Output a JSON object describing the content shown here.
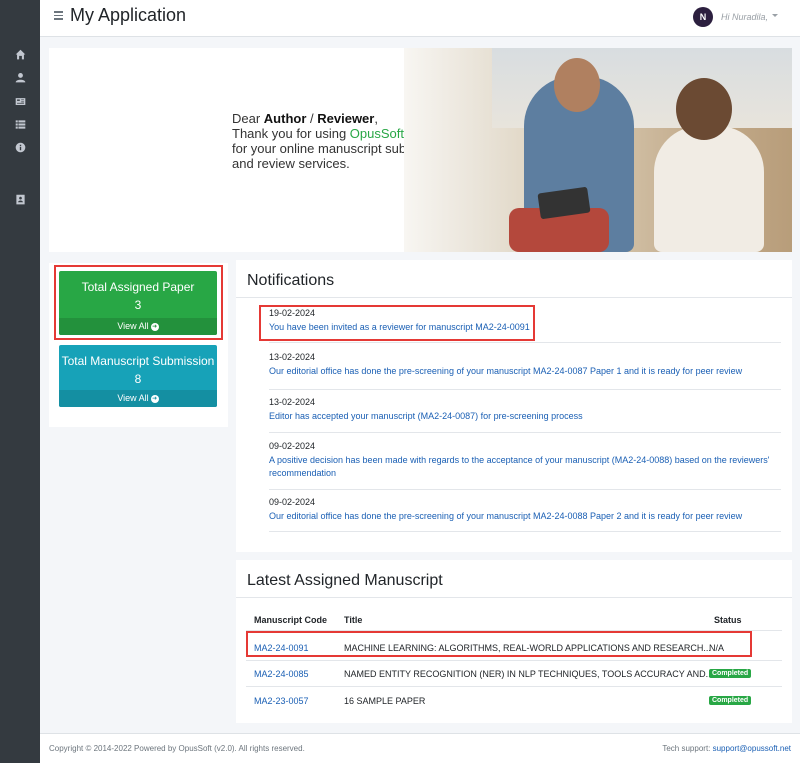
{
  "header": {
    "app_title": "My Application",
    "avatar_initial": "N",
    "greeting": "Hi Nuradila,"
  },
  "sidebar": {
    "icons": [
      "home-icon",
      "user-icon",
      "newspaper-icon",
      "list-icon",
      "info-icon",
      "contact-book-icon"
    ]
  },
  "banner": {
    "line1_prefix": "Dear ",
    "author": "Author",
    "sep": " / ",
    "reviewer": "Reviewer",
    "comma": ",",
    "line2_prefix": "Thank you for using ",
    "brand": "OpusSoft",
    "line3": "for your online manuscript submission",
    "line4": "and review services."
  },
  "stats": {
    "assigned": {
      "title": "Total Assigned Paper",
      "value": "3",
      "footer": "View All"
    },
    "submission": {
      "title": "Total Manuscript Submission",
      "value": "8",
      "footer": "View All"
    }
  },
  "notifications": {
    "title": "Notifications",
    "items": [
      {
        "date": "19-02-2024",
        "message": "You have been invited as a reviewer for manuscript MA2-24-0091"
      },
      {
        "date": "13-02-2024",
        "message": "Our editorial office has done the pre-screening of your manuscript MA2-24-0087 Paper 1 and it is ready for peer review"
      },
      {
        "date": "13-02-2024",
        "message": "Editor has accepted your manuscript (MA2-24-0087) for pre-screening process"
      },
      {
        "date": "09-02-2024",
        "message_line1": "A positive decision has been made with regards to the acceptance of your manuscript (MA2-24-0088) based on the reviewers'",
        "message_line2": "recommendation"
      },
      {
        "date": "09-02-2024",
        "message": "Our editorial office has done the pre-screening of your manuscript MA2-24-0088 Paper 2 and it is ready for peer review"
      }
    ]
  },
  "manuscripts": {
    "title": "Latest Assigned Manuscript",
    "columns": [
      "Manuscript Code",
      "Title",
      "Status"
    ],
    "rows": [
      {
        "code": "MA2-24-0091",
        "title": "MACHINE LEARNING: ALGORITHMS, REAL-WORLD APPLICATIONS AND RESEARCH...",
        "status": "N/A"
      },
      {
        "code": "MA2-24-0085",
        "title": "NAMED ENTITY RECOGNITION (NER) IN NLP TECHNIQUES, TOOLS ACCURACY AND...",
        "status": "Completed"
      },
      {
        "code": "MA2-23-0057",
        "title": "16 SAMPLE PAPER",
        "status": "Completed"
      }
    ]
  },
  "footer": {
    "copyright": "Copyright © 2014-2022 Powered by OpusSoft (v2.0). All rights reserved.",
    "support_label": "Tech support: ",
    "support_email": "support@opussoft.net"
  },
  "colors": {
    "sidebar": "#343a40",
    "green": "#28a745",
    "teal": "#17a2b8",
    "link": "#1a5fb4",
    "highlight": "#e53935"
  }
}
